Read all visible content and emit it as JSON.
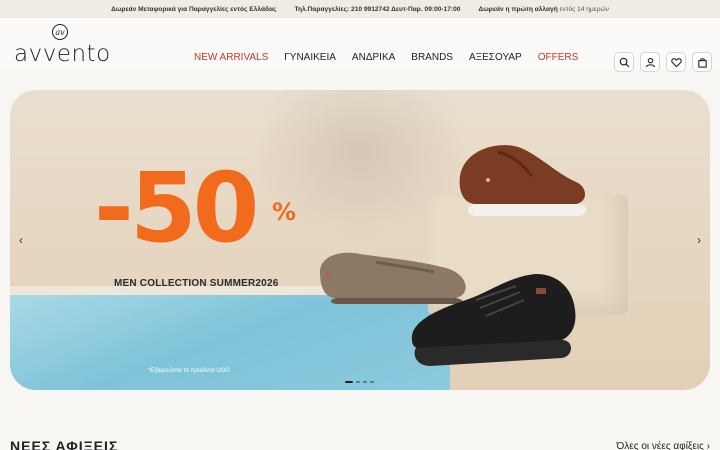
{
  "topbar": {
    "shipping": "Δωρεάν Μεταφορικά για Παραγγελίες εντός Ελλάδας",
    "phone": "Τηλ.Παραγγελίες: 210 9912742 Δευτ-Παρ. 09:00-17:00",
    "exchange_bold": "Δωρεάν η πρώτη αλλαγή",
    "exchange_rest": " εντός 14 ημερών"
  },
  "header": {
    "logo_text": "avvento",
    "logo_mark": "av",
    "nav": [
      {
        "label": "NEW ARRIVALS",
        "accent": true
      },
      {
        "label": "ΓΥΝΑΙΚΕΙΑ",
        "accent": false
      },
      {
        "label": "ΑΝΔΡΙΚΑ",
        "accent": false
      },
      {
        "label": "BRANDS",
        "accent": false
      },
      {
        "label": "ΑΞΕΣΟΥΑΡ",
        "accent": false
      },
      {
        "label": "OFFERS",
        "accent": true
      }
    ],
    "icons": [
      "search-icon",
      "user-icon",
      "heart-icon",
      "bag-icon"
    ]
  },
  "hero": {
    "discount": "-50",
    "percent": "%",
    "subtitle": "MEN COLLECTION SUMMER2026",
    "note": "*Εξαιρούνται τα προϊόντα UGG",
    "prev": "‹",
    "next": "›",
    "slides": 4,
    "active_slide": 1
  },
  "section": {
    "title": "ΝΕΕΣ ΑΦΙΞΕΙΣ",
    "see_all": "Όλες οι νέες αφίξεις ›"
  },
  "colors": {
    "accent": "#c0392b",
    "promo": "#f26b1d",
    "topbar_bg": "#f1ece3"
  }
}
